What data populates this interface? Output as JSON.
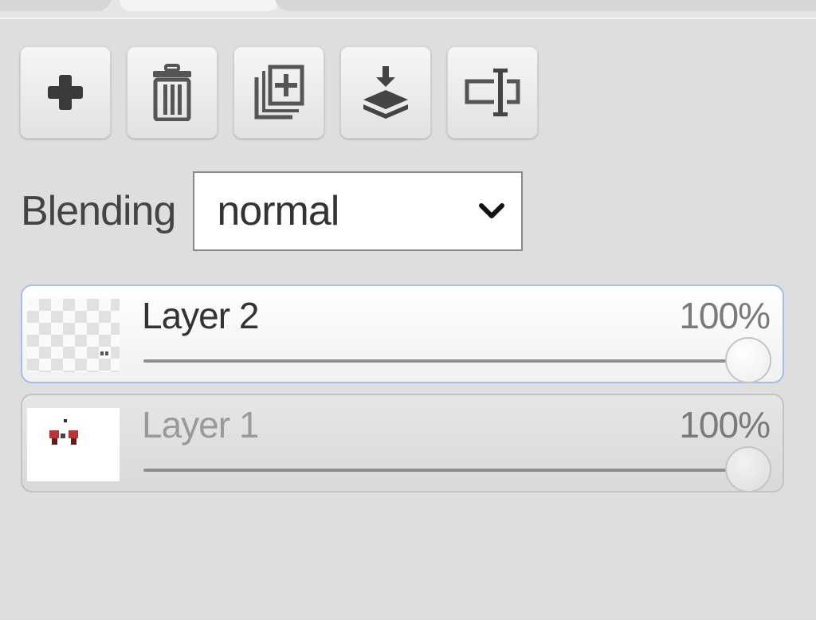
{
  "icons": {
    "add": "plus-icon",
    "delete": "trash-icon",
    "duplicate": "duplicate-layer-icon",
    "merge": "merge-down-icon",
    "rename": "rename-layer-icon"
  },
  "blending": {
    "label": "Blending",
    "value": "normal"
  },
  "layers": [
    {
      "name": "Layer 2",
      "opacity": "100%",
      "opacity_value": 1.0,
      "selected": true,
      "thumbnail": "transparent"
    },
    {
      "name": "Layer 1",
      "opacity": "100%",
      "opacity_value": 1.0,
      "selected": false,
      "thumbnail": "white"
    }
  ],
  "colors": {
    "selected_border": "#a7bde6",
    "panel_background": "#dedede"
  }
}
